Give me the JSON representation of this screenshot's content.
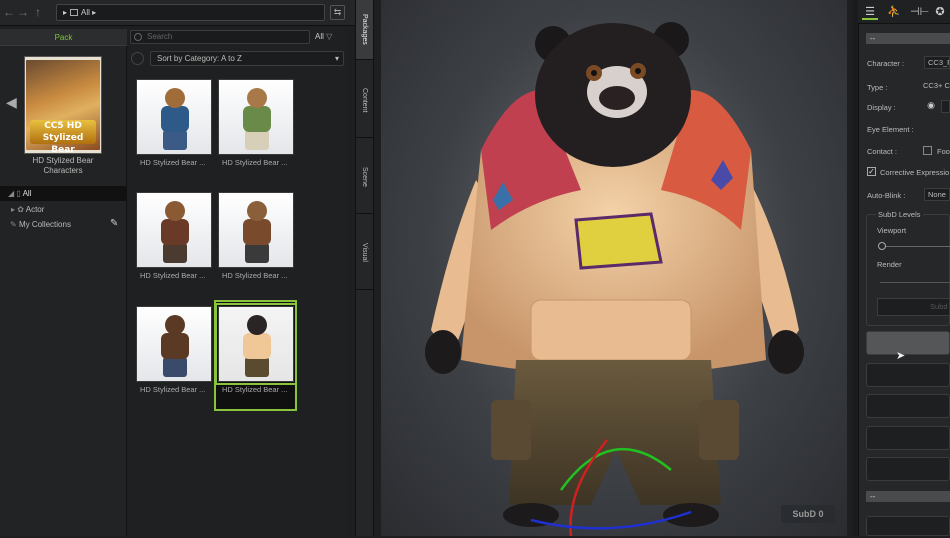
{
  "nav": {
    "back": "←",
    "forward": "→",
    "up": "↑",
    "path_arrow": "▸",
    "path": "All",
    "path_end": "▸",
    "swap": "⇆"
  },
  "left": {
    "tab": "Pack",
    "pack_badge": "CC5 HD Stylized Bear",
    "pack_caption": "HD Stylized Bear Characters",
    "tree": {
      "all": "All",
      "actor": "Actor",
      "collections": "My Collections"
    }
  },
  "content": {
    "search_placeholder": "Search",
    "filter": "All",
    "sort": "Sort by Category: A to Z",
    "items": [
      {
        "caption": "HD Stylized Bear ...",
        "fur": "#a06c3a",
        "top": "#2e5a8a",
        "pants": "#3c5a86"
      },
      {
        "caption": "HD Stylized Bear ...",
        "fur": "#a87848",
        "top": "#6a8a4a",
        "pants": "#d8cfb8"
      },
      {
        "caption": "HD Stylized Bear ...",
        "fur": "#8a5a34",
        "top": "#6a3a28",
        "pants": "#4a3a30"
      },
      {
        "caption": "HD Stylized Bear ...",
        "fur": "#8a603a",
        "top": "#7a4a2c",
        "pants": "#3a3a3a"
      },
      {
        "caption": "HD Stylized Bear ...",
        "fur": "#5a3a24",
        "top": "#5a3a24",
        "pants": "#3a4a6a"
      },
      {
        "caption": "HD Stylized Bear ...",
        "fur": "#2a2424",
        "top": "#f0c898",
        "pants": "#5a4a30"
      }
    ],
    "selected_index": 5
  },
  "vtabs": [
    "Packages",
    "Content",
    "Scene",
    "Visual"
  ],
  "viewport": {
    "subd": "SubD 0"
  },
  "right": {
    "section_top": "--",
    "character_label": "Character :",
    "character_value": "CC3_F",
    "type_label": "Type :",
    "type_value": "CC3+ Ch",
    "display_label": "Display :",
    "eye_label": "Eye Element :",
    "contact_label": "Contact :",
    "contact_value": "Foo",
    "corrective_label": "Corrective Expressio",
    "autoblink_label": "Auto-Blink :",
    "autoblink_value": "None",
    "subd_group": "SubD Levels",
    "viewport_label": "Viewport",
    "render_label": "Render",
    "subd_button": "Subd",
    "section_bottom": "--"
  }
}
